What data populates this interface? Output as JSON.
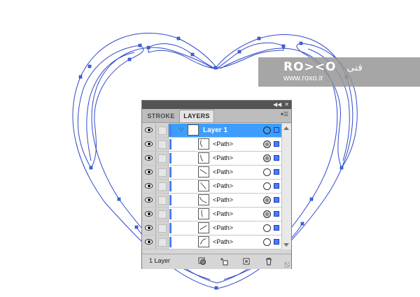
{
  "watermark": {
    "logo": "RO><O",
    "logo_suffix": "فنی",
    "url": "www.roxo.ir"
  },
  "panel": {
    "tabs": [
      {
        "label": "STROKE"
      },
      {
        "label": "LAYERS"
      }
    ],
    "active_tab": "LAYERS",
    "layer": {
      "name": "Layer 1",
      "expanded": true,
      "selected": true
    },
    "paths": [
      {
        "name": "<Path>",
        "target": "filled"
      },
      {
        "name": "<Path>",
        "target": "filled"
      },
      {
        "name": "<Path>",
        "target": "outline"
      },
      {
        "name": "<Path>",
        "target": "outline"
      },
      {
        "name": "<Path>",
        "target": "filled"
      },
      {
        "name": "<Path>",
        "target": "filled"
      },
      {
        "name": "<Path>",
        "target": "outline"
      },
      {
        "name": "<Path>",
        "target": "outline"
      }
    ],
    "footer": {
      "layer_count": "1 Layer"
    }
  },
  "colors": {
    "artwork_stroke": "#2f49c9",
    "anchor_point": "#3a6bff",
    "layer_highlight": "#3c9dfc",
    "layer_color": "#4a7cff",
    "panel_bg": "#d6d6d6"
  },
  "icons": {
    "visibility": "eye-icon",
    "expand": "triangle-down-icon",
    "target": "circle-target-icon",
    "selection": "square-selection-icon",
    "make_clipping_mask": "clipping-mask-icon",
    "create_sublayer": "new-sublayer-icon",
    "create_layer": "new-layer-icon",
    "delete": "trash-icon",
    "panel_menu": "panel-menu-icon"
  }
}
